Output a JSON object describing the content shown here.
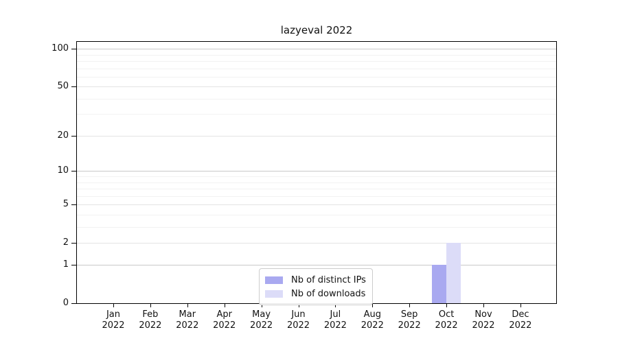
{
  "chart_data": {
    "type": "bar",
    "title": "lazyeval 2022",
    "year": "2022",
    "months": [
      "Jan",
      "Feb",
      "Mar",
      "Apr",
      "May",
      "Jun",
      "Jul",
      "Aug",
      "Sep",
      "Oct",
      "Nov",
      "Dec"
    ],
    "series": [
      {
        "name": "Nb of distinct IPs",
        "color": "#a9a9f0",
        "values": [
          0,
          0,
          0,
          0,
          0,
          0,
          0,
          0,
          0,
          1,
          0,
          0
        ]
      },
      {
        "name": "Nb of downloads",
        "color": "#dcdcf8",
        "values": [
          0,
          0,
          0,
          0,
          0,
          0,
          0,
          0,
          0,
          2,
          0,
          0
        ]
      }
    ],
    "yscale": "log1p",
    "ylim": [
      0,
      114
    ],
    "yticks": [
      0,
      1,
      2,
      5,
      10,
      20,
      50,
      100
    ],
    "major_gridlines": [
      1,
      10,
      100
    ],
    "mid_gridlines": [
      2,
      5,
      20,
      50
    ],
    "minor_gridlines": [
      3,
      4,
      6,
      7,
      8,
      9,
      30,
      40,
      60,
      70,
      80,
      90
    ],
    "grid": "horizontal",
    "legend_position": "lower center",
    "xlabel": "",
    "ylabel": ""
  }
}
